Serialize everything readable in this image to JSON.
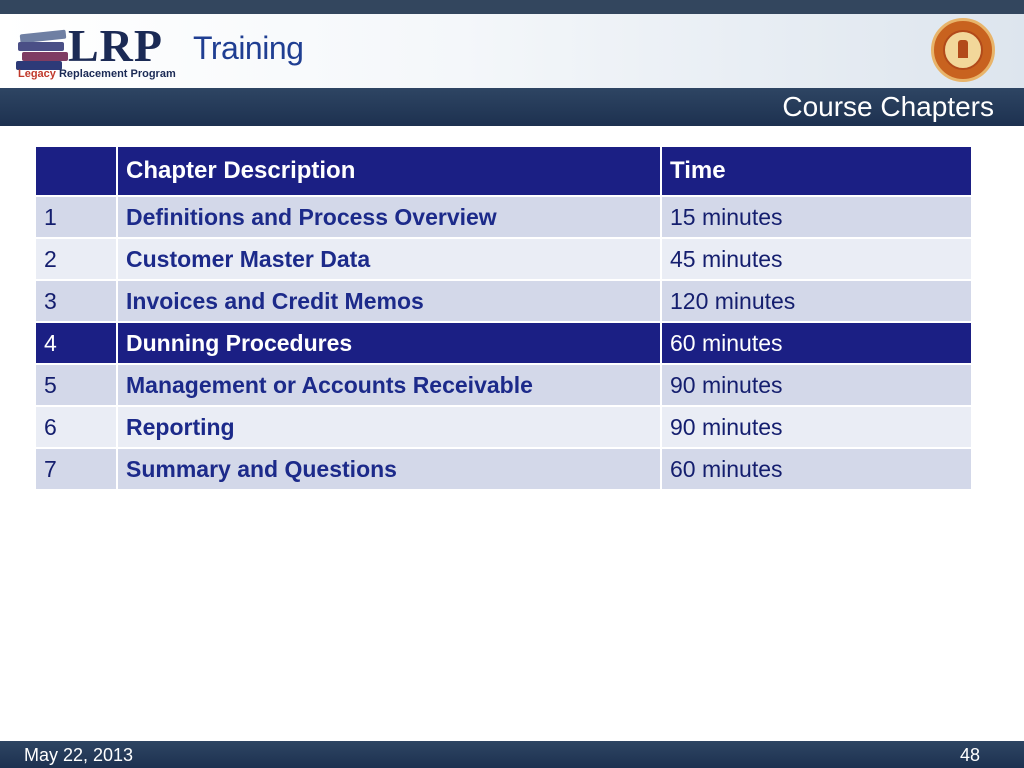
{
  "header": {
    "logo_mark": "LRP",
    "logo_sub_accent": "Legacy",
    "logo_sub_rest": " Replacement Program",
    "title": "Training"
  },
  "title_bar": {
    "title": "Course Chapters"
  },
  "table": {
    "headers": [
      "",
      "Chapter Description",
      "Time"
    ],
    "highlighted_chapter": "4",
    "rows": [
      {
        "num": "1",
        "desc": "Definitions and Process Overview",
        "time": "15 minutes"
      },
      {
        "num": "2",
        "desc": "Customer Master Data",
        "time": "45 minutes"
      },
      {
        "num": "3",
        "desc": "Invoices and Credit Memos",
        "time": "120 minutes"
      },
      {
        "num": "4",
        "desc": "Dunning Procedures",
        "time": "60 minutes"
      },
      {
        "num": "5",
        "desc": "Management or Accounts Receivable",
        "time": "90 minutes"
      },
      {
        "num": "6",
        "desc": "Reporting",
        "time": "90 minutes"
      },
      {
        "num": "7",
        "desc": "Summary and Questions",
        "time": "60 minutes"
      }
    ]
  },
  "footer": {
    "date": "May 22, 2013",
    "page": "48"
  },
  "colors": {
    "header_blue": "#1b1f84",
    "bar_navy": "#1d3150",
    "row_odd": "#d3d8e9",
    "row_even": "#eaedf5"
  },
  "icons": {
    "logo": "books-stack-icon",
    "seal": "school-district-seal-icon"
  }
}
